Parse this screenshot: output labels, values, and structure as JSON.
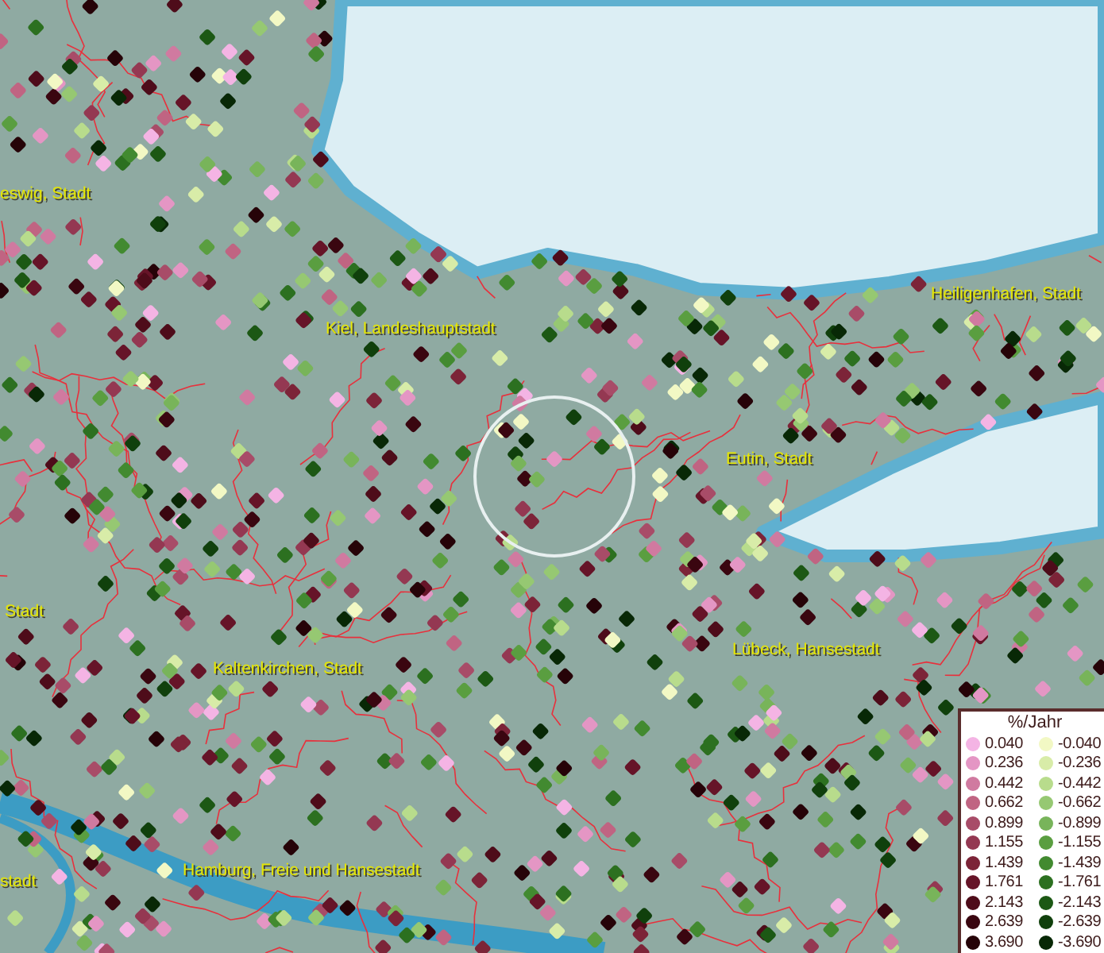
{
  "map": {
    "place_labels": [
      {
        "text": "eswig, Stadt"
      },
      {
        "text": "Kiel, Landeshauptstadt"
      },
      {
        "text": "Heiligenhafen, Stadt"
      },
      {
        "text": "Eutin, Stadt"
      },
      {
        "text": "Stadt"
      },
      {
        "text": "Kaltenkirchen, Stadt"
      },
      {
        "text": "Lübeck, Hansestadt"
      },
      {
        "text": "stadt"
      },
      {
        "text": "Hamburg, Freie und Hansestadt"
      }
    ]
  },
  "legend": {
    "title": "%/Jahr",
    "rows": [
      {
        "positive": {
          "label": "0.040",
          "color": "#f4b4e4"
        },
        "negative": {
          "label": "-0.040",
          "color": "#f2f8c4"
        }
      },
      {
        "positive": {
          "label": "0.236",
          "color": "#e496c4"
        },
        "negative": {
          "label": "-0.236",
          "color": "#d8eca8"
        }
      },
      {
        "positive": {
          "label": "0.442",
          "color": "#d07aa0"
        },
        "negative": {
          "label": "-0.442",
          "color": "#b8dc8c"
        }
      },
      {
        "positive": {
          "label": "0.662",
          "color": "#c06482"
        },
        "negative": {
          "label": "-0.662",
          "color": "#96c872"
        }
      },
      {
        "positive": {
          "label": "0.899",
          "color": "#a84c68"
        },
        "negative": {
          "label": "-0.899",
          "color": "#78b45a"
        }
      },
      {
        "positive": {
          "label": "1.155",
          "color": "#943852"
        },
        "negative": {
          "label": "-1.155",
          "color": "#5a9e40"
        }
      },
      {
        "positive": {
          "label": "1.439",
          "color": "#7c2438"
        },
        "negative": {
          "label": "-1.439",
          "color": "#428a30"
        }
      },
      {
        "positive": {
          "label": "1.761",
          "color": "#661428"
        },
        "negative": {
          "label": "-1.761",
          "color": "#2c7020"
        }
      },
      {
        "positive": {
          "label": "2.143",
          "color": "#4e0c1a"
        },
        "negative": {
          "label": "-2.143",
          "color": "#1c5814"
        }
      },
      {
        "positive": {
          "label": "2.639",
          "color": "#3a0610"
        },
        "negative": {
          "label": "-2.639",
          "color": "#10400c"
        }
      },
      {
        "positive": {
          "label": "3.690",
          "color": "#260308"
        },
        "negative": {
          "label": "-3.690",
          "color": "#082806"
        }
      }
    ]
  }
}
